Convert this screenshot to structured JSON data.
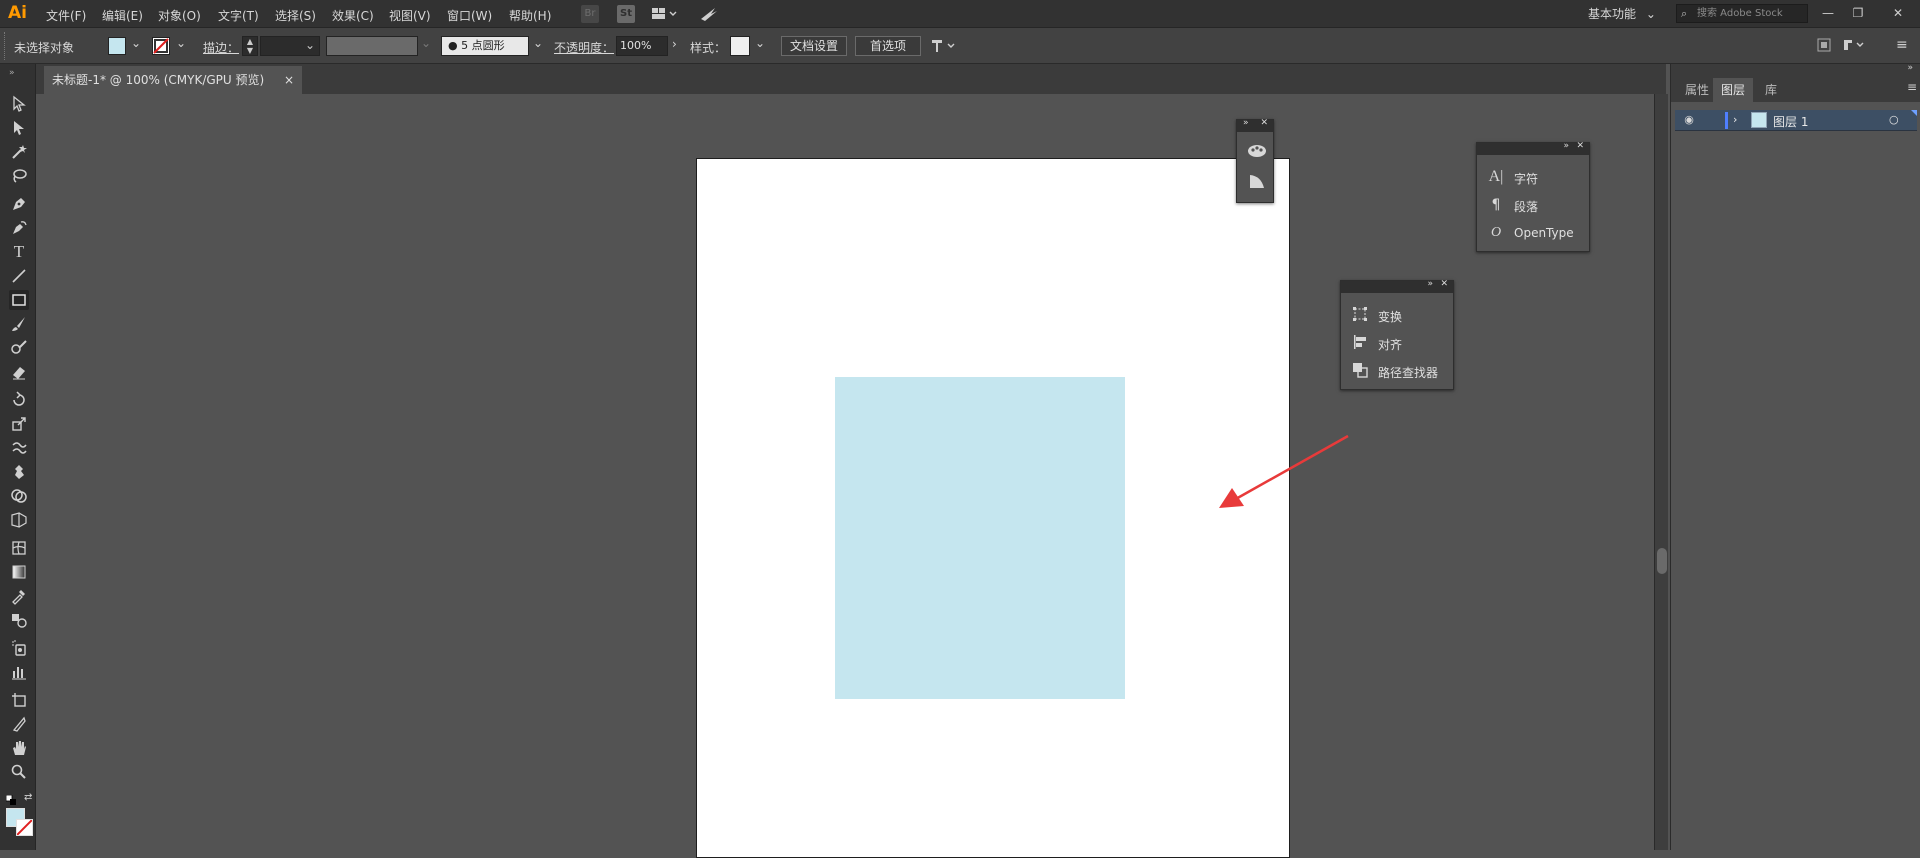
{
  "app": {
    "logo": "Ai"
  },
  "menu": [
    "文件(F)",
    "编辑(E)",
    "对象(O)",
    "文字(T)",
    "选择(S)",
    "效果(C)",
    "视图(V)",
    "窗口(W)",
    "帮助(H)"
  ],
  "menubar_icons": {
    "bridge": "Br",
    "stock": "St"
  },
  "workspace": {
    "label": "基本功能"
  },
  "stock_search": {
    "placeholder": "搜索 Adobe Stock"
  },
  "control": {
    "selection_status": "未选择对象",
    "stroke_label": "描边：",
    "brush_label": "5 点圆形",
    "opacity_label": "不透明度：",
    "opacity_value": "100%",
    "style_label": "样式：",
    "doc_setup": "文档设置",
    "preferences": "首选项"
  },
  "document_tab": {
    "title": "未标题-1* @ 100% (CMYK/GPU 预览)",
    "close": "×"
  },
  "colors": {
    "fill": "#c5e6ef",
    "accent_arrow": "#e83a3a",
    "panel_bg": "#535353",
    "layer_highlight": "#3d4f64"
  },
  "type_panel": {
    "items": [
      {
        "icon": "character-icon",
        "glyph": "A",
        "label": "字符"
      },
      {
        "icon": "paragraph-icon",
        "glyph": "¶",
        "label": "段落"
      },
      {
        "icon": "opentype-icon",
        "glyph": "O",
        "label": "OpenType"
      }
    ]
  },
  "transform_panel": {
    "items": [
      {
        "icon": "transform-icon",
        "label": "变换"
      },
      {
        "icon": "align-icon",
        "label": "对齐"
      },
      {
        "icon": "pathfinder-icon",
        "label": "路径查找器"
      }
    ]
  },
  "right_panel": {
    "tabs": [
      "属性",
      "图层",
      "库"
    ],
    "active_tab": "图层",
    "layers": [
      {
        "name": "图层 1"
      }
    ]
  }
}
